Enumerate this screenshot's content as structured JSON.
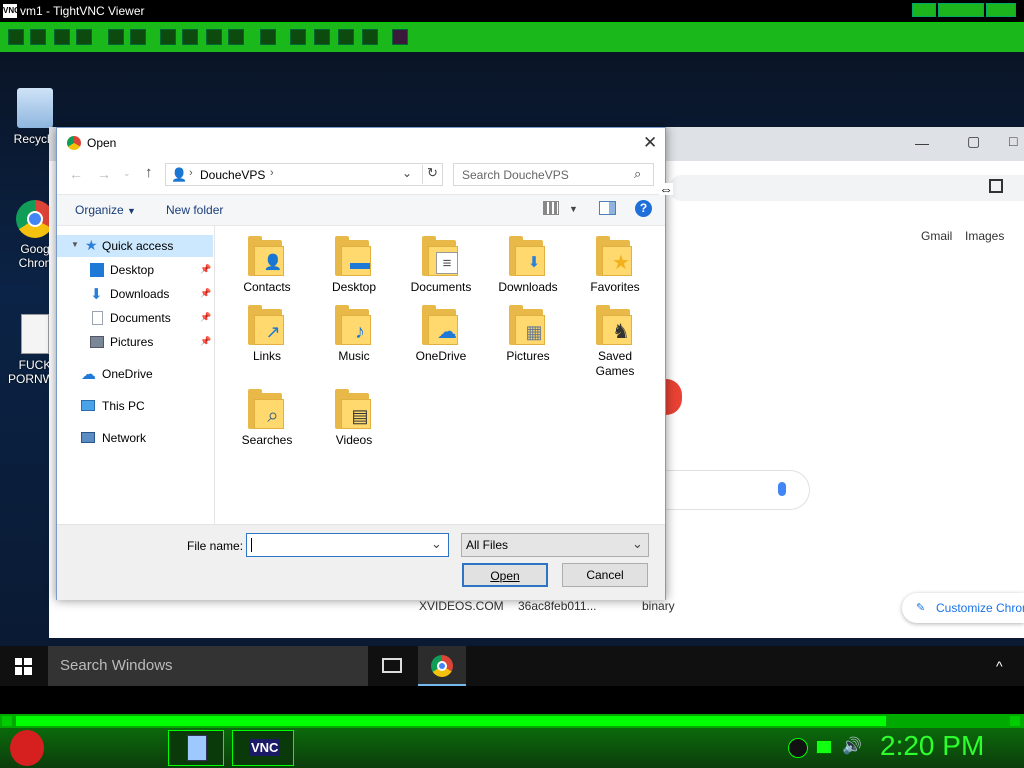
{
  "vnc": {
    "title": "vm1 - TightVNC Viewer",
    "icon_text": "VNC"
  },
  "desktop": {
    "icons": [
      {
        "label": "Recycle",
        "icon": "recycle-bin-icon"
      },
      {
        "label": "Goog\nChron",
        "icon": "chrome-icon"
      },
      {
        "label": "FUCK\nPORNWE",
        "icon": "document-icon"
      }
    ]
  },
  "chrome": {
    "links": [
      "Gmail",
      "Images"
    ],
    "customize": "Customize Chrom",
    "row_values": [
      "XVIDEOS.COM",
      "36ac8feb011...",
      "binary"
    ]
  },
  "dialog": {
    "title": "Open",
    "address": {
      "segment": "DoucheVPS"
    },
    "search_placeholder": "Search DoucheVPS",
    "organize_label": "Organize",
    "new_folder_label": "New folder",
    "nav": {
      "quick_access": "Quick access",
      "pinned": [
        {
          "label": "Desktop",
          "icon": "desktop-icon",
          "color": "#1e7ad6"
        },
        {
          "label": "Downloads",
          "icon": "download-icon",
          "color": "#2b7fd8"
        },
        {
          "label": "Documents",
          "icon": "documents-icon",
          "color": "#9aa4b0"
        },
        {
          "label": "Pictures",
          "icon": "pictures-icon",
          "color": "#7a8796"
        }
      ],
      "onedrive": "OneDrive",
      "this_pc": "This PC",
      "network": "Network"
    },
    "files": [
      {
        "label": "Contacts",
        "icon": "contacts-icon",
        "badge": "👤"
      },
      {
        "label": "Desktop",
        "icon": "desktop-icon",
        "badge": "▬"
      },
      {
        "label": "Documents",
        "icon": "documents-icon",
        "badge": "≡"
      },
      {
        "label": "Downloads",
        "icon": "download-icon",
        "badge": "⬇"
      },
      {
        "label": "Favorites",
        "icon": "star-icon",
        "badge": "★"
      },
      {
        "label": "Links",
        "icon": "link-icon",
        "badge": "↗"
      },
      {
        "label": "Music",
        "icon": "music-icon",
        "badge": "♪"
      },
      {
        "label": "OneDrive",
        "icon": "cloud-icon",
        "badge": "☁"
      },
      {
        "label": "Pictures",
        "icon": "pictures-icon",
        "badge": "▦"
      },
      {
        "label": "Saved\nGames",
        "icon": "chess-knight-icon",
        "badge": "♞"
      },
      {
        "label": "Searches",
        "icon": "magnifier-icon",
        "badge": "⌕"
      },
      {
        "label": "Videos",
        "icon": "film-icon",
        "badge": "▤"
      }
    ],
    "file_name_label": "File name:",
    "file_name_value": "",
    "filter": "All Files",
    "open_label": "Open",
    "cancel_label": "Cancel"
  },
  "taskbar": {
    "search_placeholder": "Search Windows"
  },
  "host": {
    "clock": "2:20 PM",
    "tray_vnc": "VNC"
  },
  "colors": {
    "accent_green": "#1ab81a",
    "clock_green": "#2cff2c",
    "dialog_border": "#7a9ccc",
    "help_blue": "#1e6fd9"
  }
}
